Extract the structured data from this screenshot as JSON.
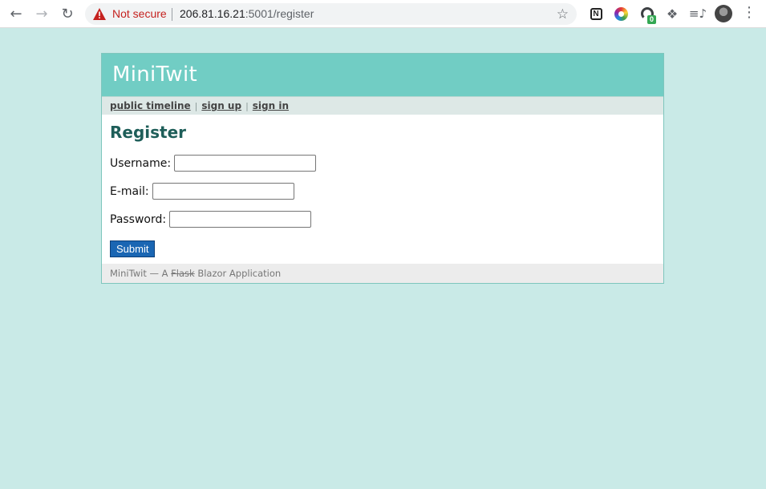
{
  "browser": {
    "security_label": "Not secure",
    "url_host": "206.81.16.21",
    "url_path": ":5001/register",
    "extension_badge": "0",
    "icons": [
      "back-icon",
      "forward-icon",
      "reload-icon",
      "warning-icon",
      "star-icon",
      "notion-icon",
      "color-picker-icon",
      "gauge-icon",
      "puzzle-icon",
      "media-control-icon",
      "profile-avatar",
      "kebab-menu-icon"
    ]
  },
  "site": {
    "title": "MiniTwit",
    "nav": {
      "public_timeline": "public timeline",
      "sign_up": "sign up",
      "sign_in": "sign in",
      "separator": "|"
    }
  },
  "form": {
    "heading": "Register",
    "username_label": "Username:",
    "email_label": "E-mail:",
    "password_label": "Password:",
    "username_value": "",
    "email_value": "",
    "password_value": "",
    "submit_label": "Submit"
  },
  "footer": {
    "prefix": "MiniTwit — A ",
    "struck": "Flask",
    "suffix": " Blazor Application"
  },
  "colors": {
    "page_bg": "#c9eae7",
    "header_bg": "#71cdc4",
    "heading": "#1e5e59",
    "submit_bg": "#1a66b3"
  }
}
